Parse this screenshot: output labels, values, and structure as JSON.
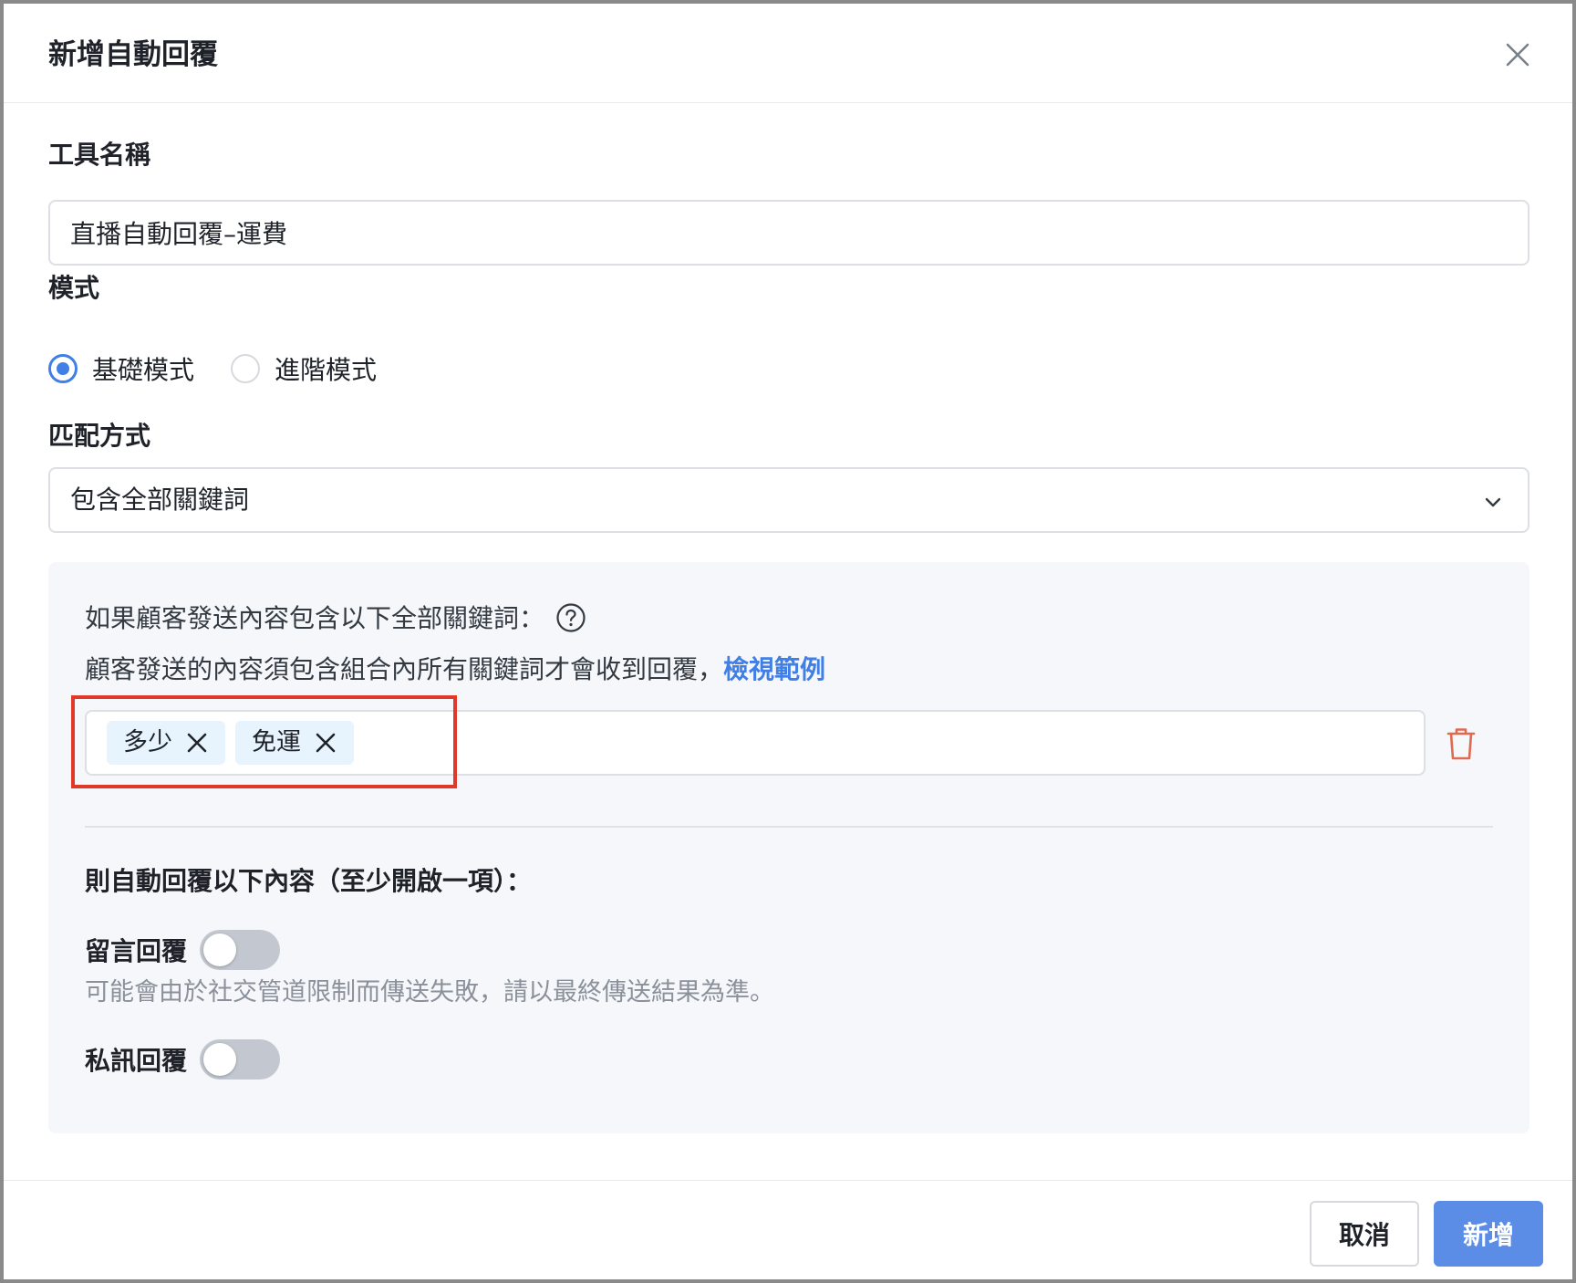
{
  "dialog": {
    "title": "新增自動回覆"
  },
  "tool_name": {
    "label": "工具名稱",
    "value": "直播自動回覆–運費"
  },
  "mode": {
    "label": "模式",
    "options": [
      {
        "label": "基礎模式",
        "checked": true
      },
      {
        "label": "進階模式",
        "checked": false
      }
    ]
  },
  "match": {
    "label": "匹配方式",
    "selected": "包含全部關鍵詞"
  },
  "keywords": {
    "condition_text": "如果顧客發送內容包含以下全部關鍵詞：",
    "description": "顧客發送的內容須包含組合內所有關鍵詞才會收到回覆，",
    "example_link": "檢視範例",
    "tags": [
      "多少",
      "免運"
    ]
  },
  "reply": {
    "section_title": "則自動回覆以下內容（至少開啟一項）：",
    "comment_label": "留言回覆",
    "comment_enabled": false,
    "comment_hint": "可能會由於社交管道限制而傳送失敗，請以最終傳送結果為準。",
    "dm_label": "私訊回覆",
    "dm_enabled": false
  },
  "footer": {
    "cancel_label": "取消",
    "submit_label": "新增"
  },
  "colors": {
    "accent": "#3f7fe6",
    "primary_button": "#5b8ce6",
    "highlight": "#e0392a",
    "danger_icon": "#e06a4f",
    "tag_bg": "#e7f3fd"
  }
}
